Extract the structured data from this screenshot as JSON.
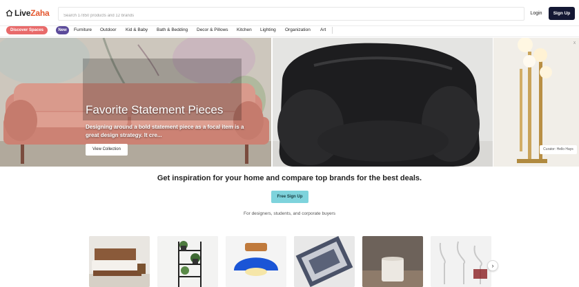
{
  "header": {
    "logo": {
      "text_dark": "Live",
      "text_accent": "Zaha"
    },
    "search": {
      "placeholder": "Search 17850 products and 12 brands",
      "value": ""
    },
    "login_label": "Login",
    "signup_label": "Sign Up"
  },
  "nav": {
    "discover_label": "Discover Spaces",
    "new_label": "New",
    "items": [
      "Furniture",
      "Outdoor",
      "Kid & Baby",
      "Bath & Bedding",
      "Decor & Pillows",
      "Kitchen",
      "Lighting",
      "Organization",
      "Art"
    ]
  },
  "hero": {
    "title": "Favorite Statement Pieces",
    "description": "Designing around a bold statement piece as a focal item is a great design strategy. It cre...",
    "button_label": "View Collection",
    "side_caption": "Curator: Hello Hays",
    "corner_mark": "X"
  },
  "cta": {
    "tagline": "Get inspiration for your home and compare top brands for the best deals.",
    "button_label": "Free Sign Up",
    "subtext": "For designers, students, and corporate buyers"
  },
  "colors": {
    "discover_pill": "#e86a6a",
    "new_pill": "#5b4a9a",
    "signup_button": "#141834",
    "free_signup_button": "#7ed3dc",
    "logo_accent": "#e4572e"
  },
  "icons": {
    "logo": "house-icon",
    "carousel_next": "chevron-right-icon",
    "carousel_next_glyph": "›"
  }
}
